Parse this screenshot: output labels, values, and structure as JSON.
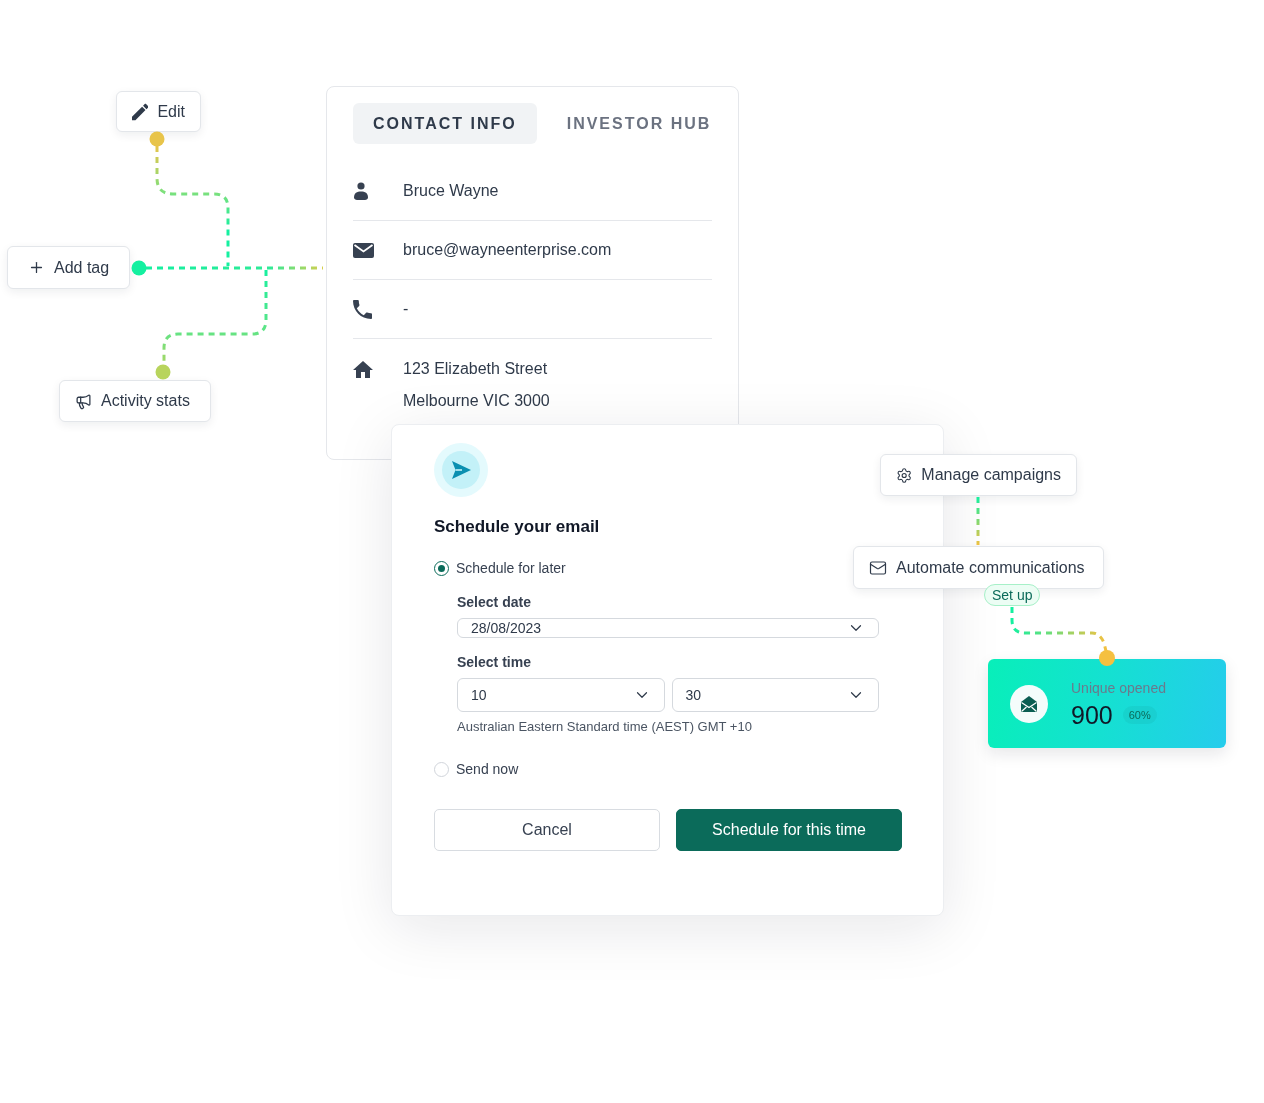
{
  "edit_button": {
    "label": "Edit"
  },
  "add_tag_button": {
    "label": "Add tag"
  },
  "activity_stats_button": {
    "label": "Activity stats"
  },
  "contact_card": {
    "tabs": [
      {
        "label": "CONTACT INFO",
        "selected": true
      },
      {
        "label": "INVESTOR HUB",
        "selected": false
      }
    ],
    "details": [
      {
        "kind": "name",
        "lines": [
          "Bruce Wayne"
        ]
      },
      {
        "kind": "email",
        "lines": [
          "bruce@wayneenterprise.com"
        ]
      },
      {
        "kind": "phone",
        "lines": [
          "-"
        ]
      },
      {
        "kind": "address",
        "lines": [
          "123 Elizabeth Street",
          "Melbourne VIC 3000"
        ]
      }
    ]
  },
  "schedule_dialog": {
    "title": "Schedule your email",
    "options": [
      {
        "label": "Schedule for later",
        "selected": true
      },
      {
        "label": "Send now",
        "selected": false
      }
    ],
    "date": {
      "label": "Select date",
      "value": "28/08/2023"
    },
    "time": {
      "label": "Select time",
      "hour": "10",
      "minute": "30",
      "note": "Australian Eastern Standard time (AEST) GMT +10"
    },
    "buttons": [
      {
        "label": "Cancel",
        "kind": "secondary"
      },
      {
        "label": "Schedule for this time",
        "kind": "primary"
      }
    ]
  },
  "manage_campaigns_button": {
    "label": "Manage campaigns"
  },
  "automate_button": {
    "label": "Automate communications",
    "badge": "Set up"
  },
  "stat_card": {
    "label": "Unique opened",
    "value": "900",
    "change": "60%"
  }
}
